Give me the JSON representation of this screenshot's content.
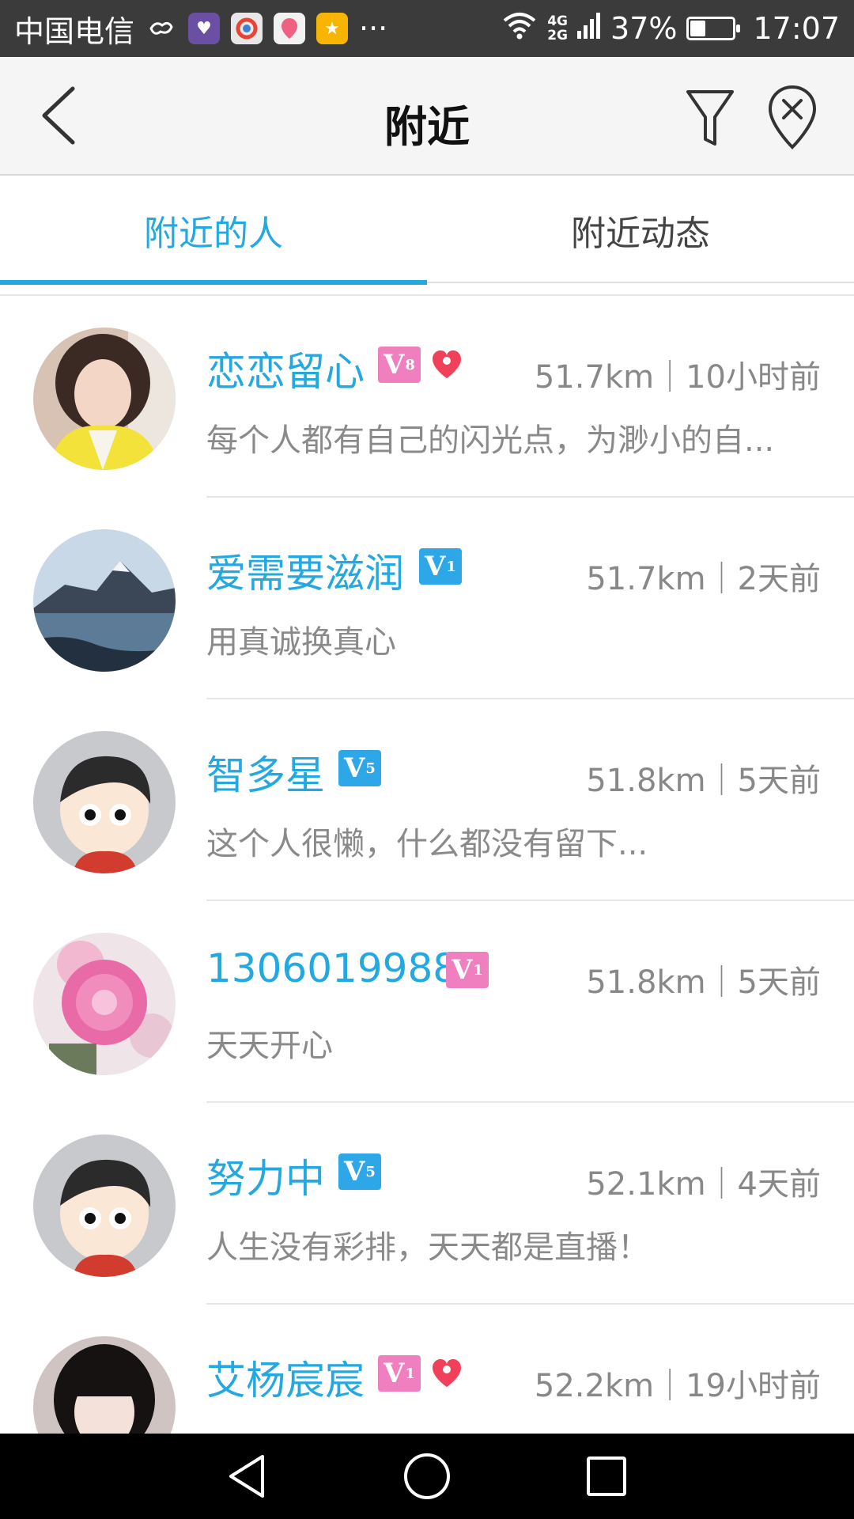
{
  "status_bar": {
    "carrier": "中国电信",
    "net_top": "4G",
    "net_bottom": "2G",
    "battery": "37%",
    "battery_level": 0.37,
    "time": "17:07",
    "more": "···"
  },
  "header": {
    "title": "附近"
  },
  "tabs": [
    {
      "label": "附近的人",
      "active": true
    },
    {
      "label": "附近动态",
      "active": false
    }
  ],
  "people": [
    {
      "name": "恋恋留心",
      "vip": "V",
      "vip_level": "8",
      "vip_color": "pink",
      "heart": true,
      "meta": "51.7km｜10小时前",
      "signature": "每个人都有自己的闪光点，为渺小的自..."
    },
    {
      "name": "爱需要滋润",
      "vip": "V",
      "vip_level": "1",
      "vip_color": "blue",
      "heart": false,
      "meta": "51.7km｜2天前",
      "signature": "用真诚换真心"
    },
    {
      "name": "智多星",
      "vip": "V",
      "vip_level": "5",
      "vip_color": "blue",
      "heart": false,
      "meta": "51.8km｜5天前",
      "signature": "这个人很懒，什么都没有留下..."
    },
    {
      "name": "1306019988",
      "vip": "V",
      "vip_level": "1",
      "vip_color": "pink",
      "heart": false,
      "meta": "51.8km｜5天前",
      "signature": "天天开心"
    },
    {
      "name": "努力中",
      "vip": "V",
      "vip_level": "5",
      "vip_color": "blue",
      "heart": false,
      "meta": "52.1km｜4天前",
      "signature": "人生没有彩排，天天都是直播！"
    },
    {
      "name": "艾杨宸宸",
      "vip": "V",
      "vip_level": "1",
      "vip_color": "pink",
      "heart": true,
      "meta": "52.2km｜19小时前",
      "signature": ""
    }
  ],
  "colors": {
    "accent": "#23a8e0",
    "vip_blue": "#2ea7e8",
    "vip_pink": "#f07fbf",
    "heart": "#f0405a"
  }
}
